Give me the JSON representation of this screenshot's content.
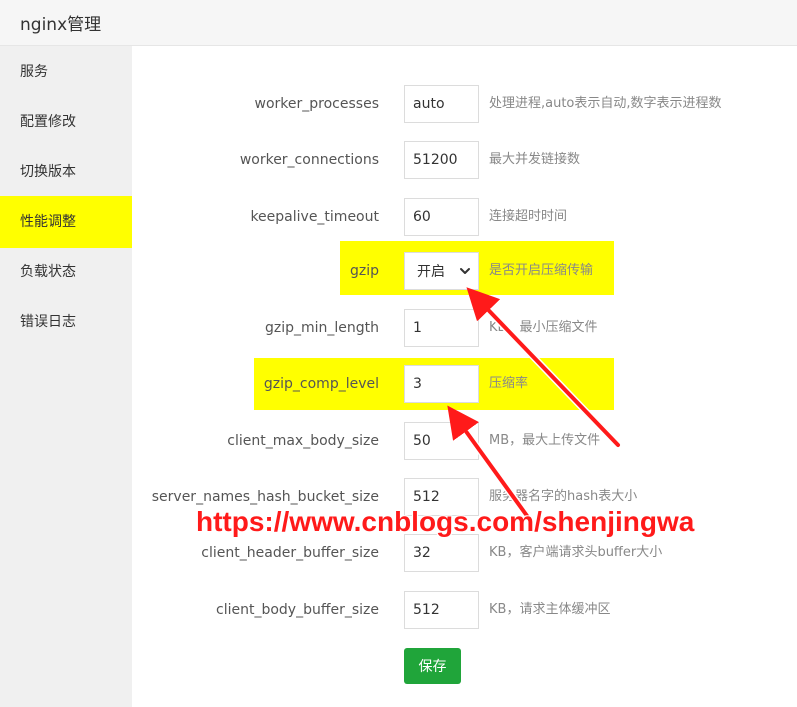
{
  "header": {
    "title": "nginx管理"
  },
  "sidebar": {
    "items": [
      {
        "label": "服务"
      },
      {
        "label": "配置修改"
      },
      {
        "label": "切换版本"
      },
      {
        "label": "性能调整",
        "active": true
      },
      {
        "label": "负载状态"
      },
      {
        "label": "错误日志"
      }
    ]
  },
  "form": {
    "rows": [
      {
        "label": "worker_processes",
        "value": "auto",
        "desc": "处理进程,auto表示自动,数字表示进程数"
      },
      {
        "label": "worker_connections",
        "value": "51200",
        "desc": "最大并发链接数"
      },
      {
        "label": "keepalive_timeout",
        "value": "60",
        "desc": "连接超时时间"
      },
      {
        "label": "gzip",
        "value": "开启",
        "desc": "是否开启压缩传输",
        "type": "select",
        "highlighted": true
      },
      {
        "label": "gzip_min_length",
        "value": "1",
        "desc": "KB，最小压缩文件"
      },
      {
        "label": "gzip_comp_level",
        "value": "3",
        "desc": "压缩率",
        "highlighted": true
      },
      {
        "label": "client_max_body_size",
        "value": "50",
        "desc": "MB，最大上传文件"
      },
      {
        "label": "server_names_hash_bucket_size",
        "value": "512",
        "desc": "服务器名字的hash表大小"
      },
      {
        "label": "client_header_buffer_size",
        "value": "32",
        "desc": "KB，客户端请求头buffer大小"
      },
      {
        "label": "client_body_buffer_size",
        "value": "512",
        "desc": "KB，请求主体缓冲区"
      }
    ],
    "save_label": "保存"
  },
  "watermark": {
    "text": "https://www.cnblogs.com/shenjingwa"
  },
  "colors": {
    "highlight": "#ffff00",
    "save_button": "#20a53a",
    "annotation": "#ff1a1a"
  }
}
